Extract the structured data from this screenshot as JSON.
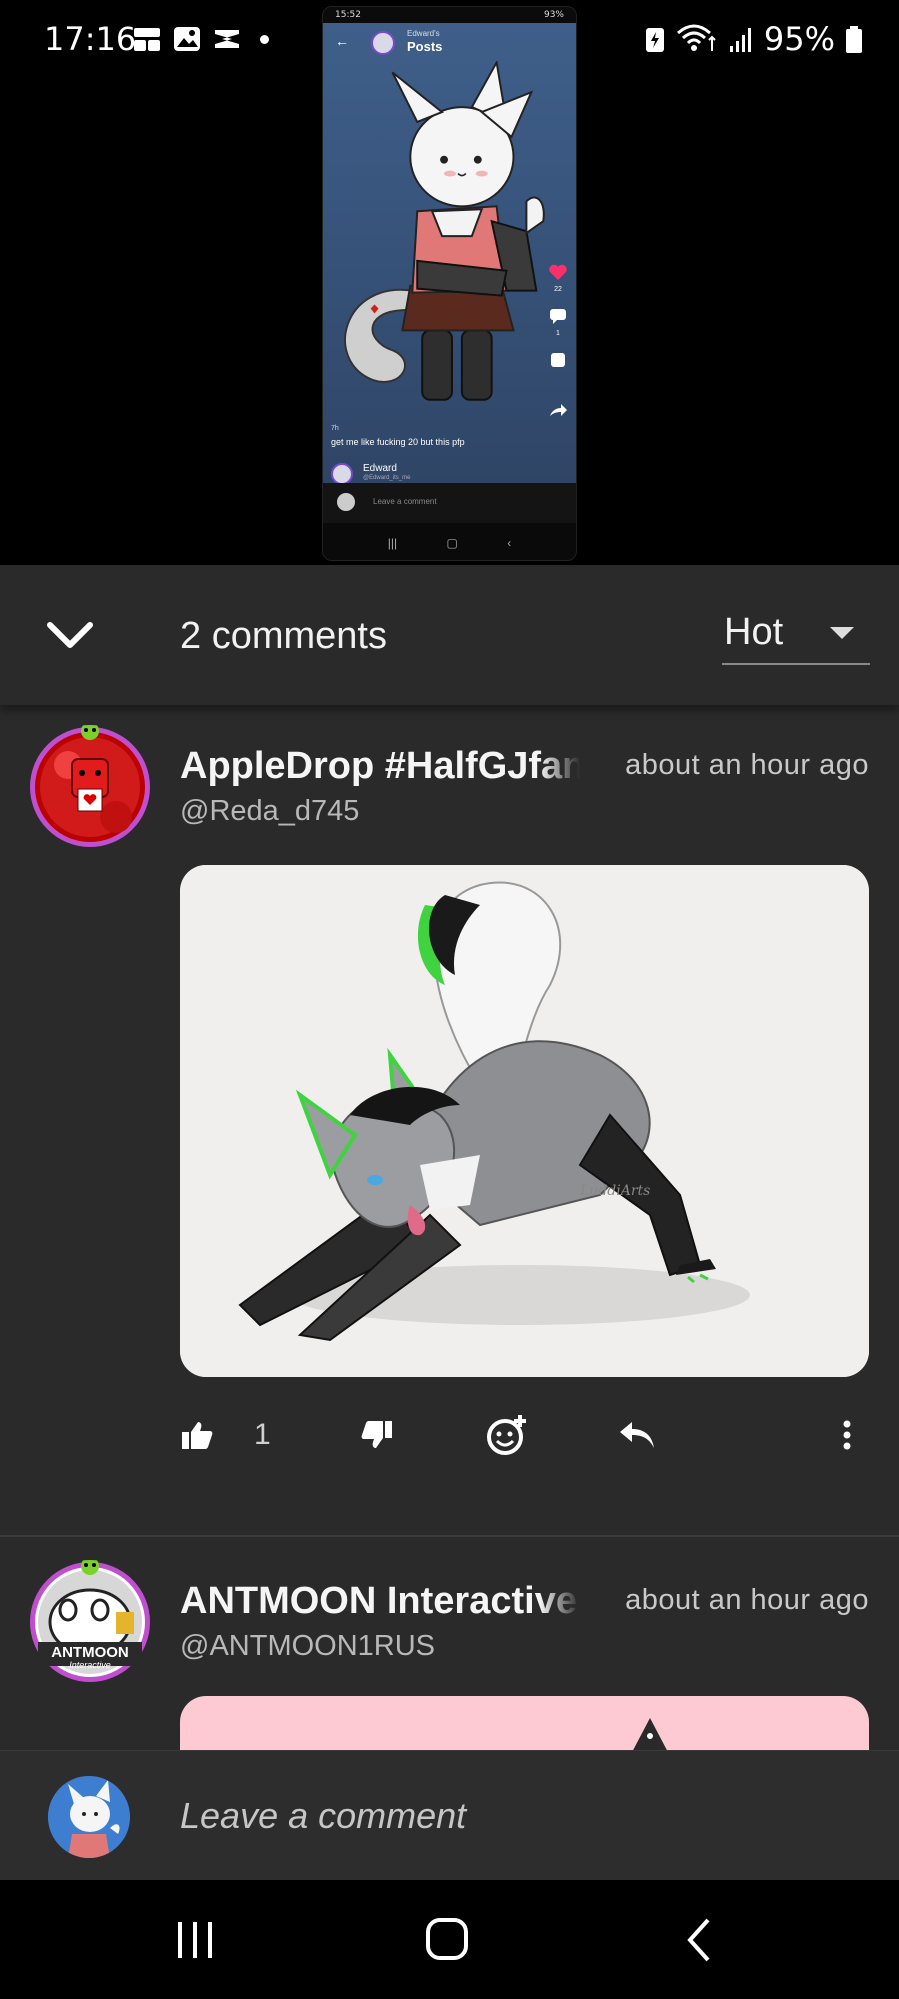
{
  "status_bar": {
    "time": "17:16",
    "battery": "95%"
  },
  "embedded_post": {
    "status_time": "15:52",
    "status_battery": "93%",
    "header_subtitle": "Edward's",
    "header_title": "Posts",
    "like_count": "22",
    "comment_count": "1",
    "caption_time": "7h",
    "caption": "get me like fucking 20 but this pfp",
    "author": "Edward",
    "author_handle": "@Edward_its_me",
    "comment_placeholder": "Leave a comment"
  },
  "sheet": {
    "comments_count": "2 comments",
    "sort": "Hot"
  },
  "comments": [
    {
      "name": "AppleDrop #HalfGJfan",
      "handle": "@Reda_d745",
      "time": "about an hour ago",
      "likes": "1",
      "image_watermark": "LuddiArts"
    },
    {
      "name": "ANTMOON Interactive",
      "handle": "@ANTMOON1RUS",
      "time": "about an hour ago",
      "avatar_text_1": "ANTMOON",
      "avatar_text_2": "Interactive"
    }
  ],
  "comment_bar": {
    "placeholder": "Leave a comment"
  },
  "colors": {
    "sheet_bg": "#2a2a2b",
    "avatar_ring": "#c04fd0",
    "green_accent": "#3fd43f"
  }
}
